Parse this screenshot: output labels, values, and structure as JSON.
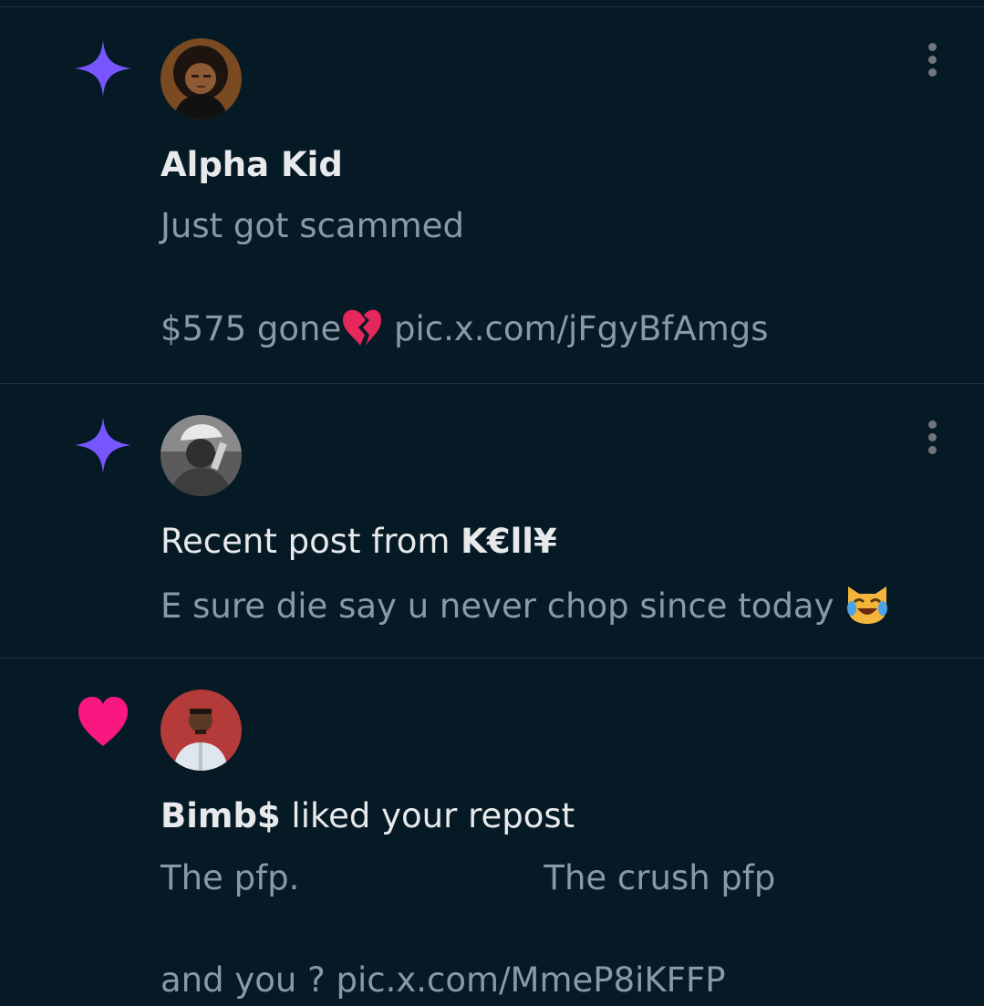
{
  "colors": {
    "background": "#061a26",
    "divider": "#22303c",
    "primary_text": "#e7e9ea",
    "secondary_text": "#8b98a5",
    "sparkle_purple": "#7856ff",
    "heart_pink": "#f91880"
  },
  "notifications": [
    {
      "kind_icon": "sparkle-icon",
      "author": "Alpha Kid",
      "lines": [
        "Just got scammed",
        "$575 gone",
        "pic.x.com/jFgyBfAmgs"
      ],
      "emoji": "broken-heart-emoji"
    },
    {
      "kind_icon": "sparkle-icon",
      "title_prefix": "Recent post from ",
      "author": "K€ll¥",
      "text": "E sure die say u never chop since today ",
      "emoji": "cat-tears-of-joy-emoji"
    },
    {
      "kind_icon": "heart-icon",
      "author": "Bimb$",
      "action": " liked your repost",
      "text_left": "The pfp.",
      "text_right": "The crush pfp",
      "text_line2": "and you ? ",
      "link": "pic.x.com/MmeP8iKFFP"
    }
  ]
}
